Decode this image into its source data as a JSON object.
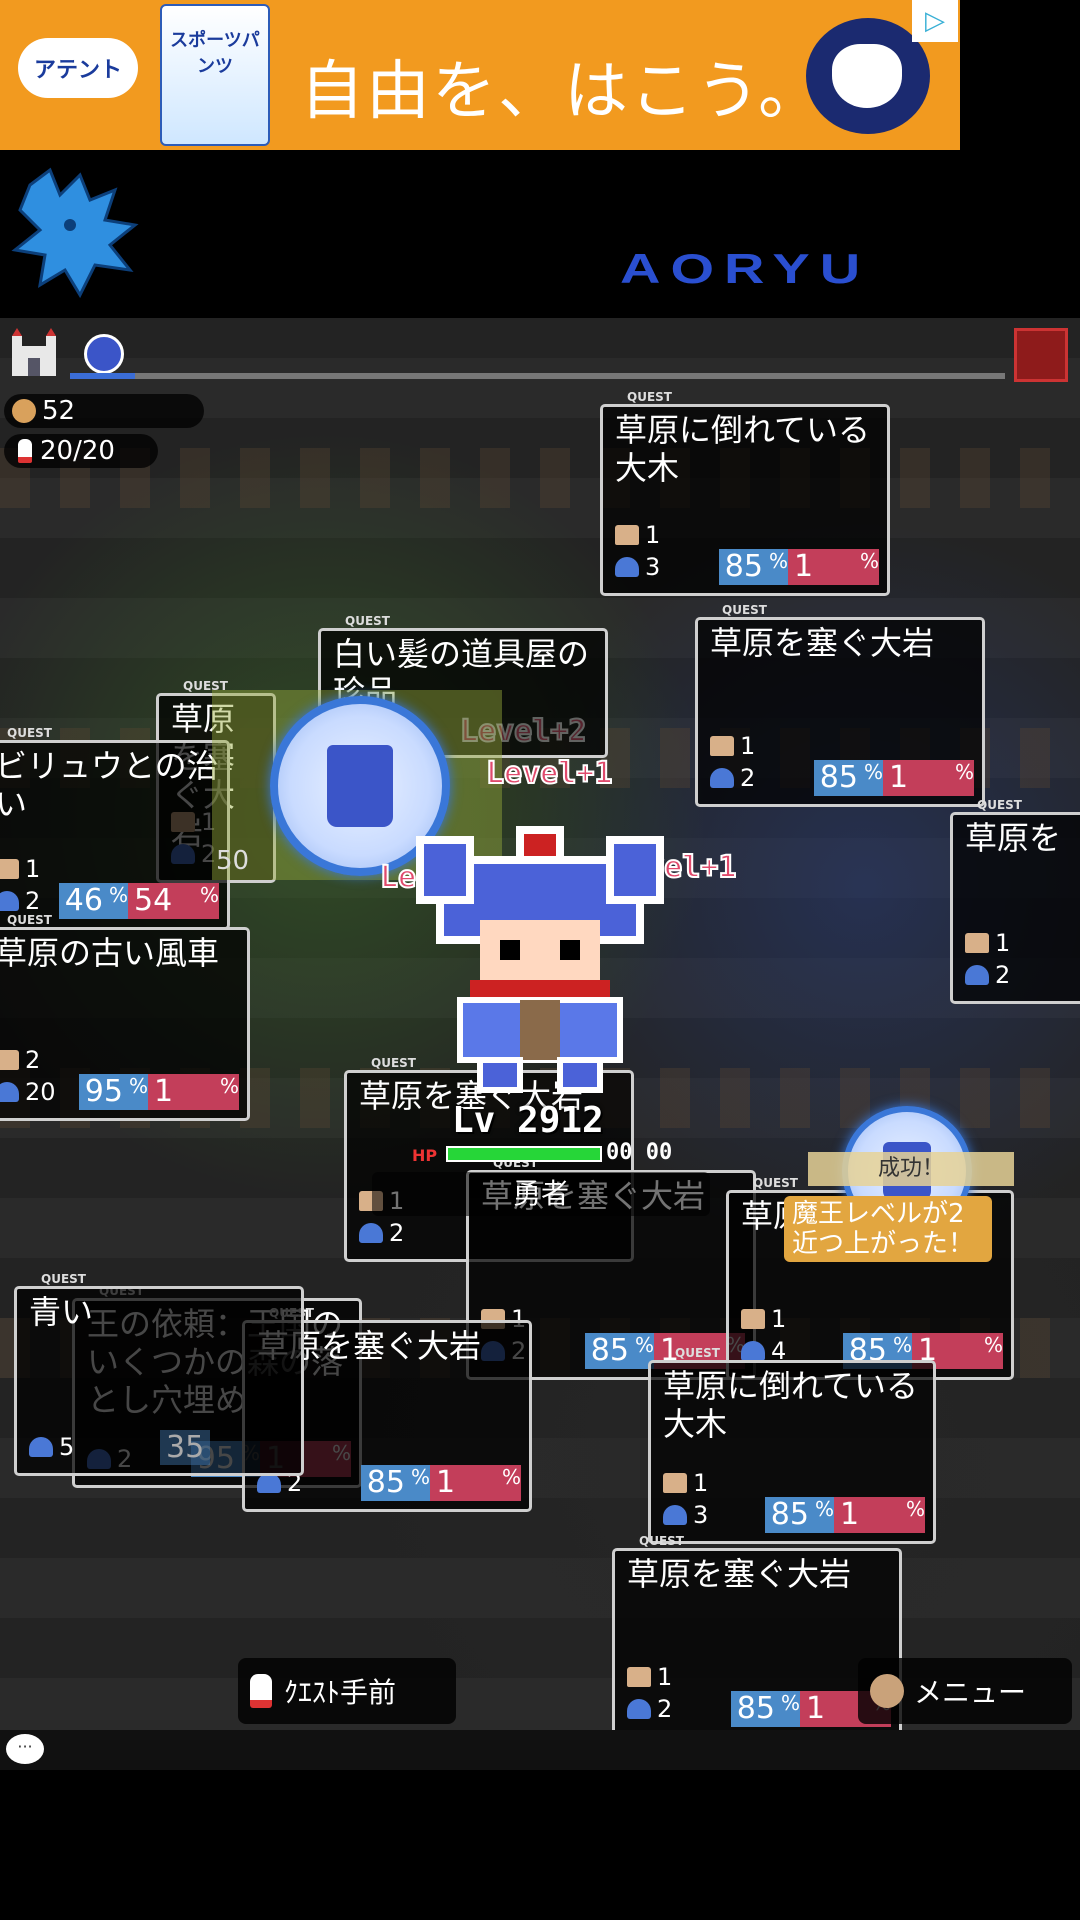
{
  "ad": {
    "brand": "アテント",
    "product": "スポーツパンツ",
    "slogan": "自由を、はこう。",
    "choice_icon": "ad-choices-icon"
  },
  "logo": {
    "text": "AORYU"
  },
  "stats": {
    "coins": "52",
    "quest_count": "20/20"
  },
  "progress": {
    "value": 0.07
  },
  "quest_tag": "QUEST",
  "quests": [
    {
      "id": "q1",
      "title": "草原に倒れている大木",
      "boot": "1",
      "slime": "3",
      "success": "85",
      "risk": "1"
    },
    {
      "id": "q2",
      "title": "草原を塞ぐ大岩",
      "boot": "1",
      "slime": "2",
      "success": "85",
      "risk": "1"
    },
    {
      "id": "q3",
      "title": "白い髪の道具屋の珍品",
      "boot": "",
      "slime": "",
      "success": "",
      "risk": ""
    },
    {
      "id": "q4",
      "title": "草原を塞ぐ大岩",
      "boot": "1",
      "slime": "2",
      "success": "",
      "risk": ""
    },
    {
      "id": "q5",
      "title": "ビリュウとの治い",
      "boot": "1",
      "slime": "2",
      "success": "46",
      "risk": "54"
    },
    {
      "id": "q6",
      "title": "草原を",
      "boot": "1",
      "slime": "2",
      "success": "",
      "risk": ""
    },
    {
      "id": "q7",
      "title": "草原の古い風車",
      "boot": "2",
      "slime": "20",
      "success": "95",
      "risk": "1"
    },
    {
      "id": "q8",
      "title": "草原を塞ぐ大岩",
      "boot": "1",
      "slime": "2",
      "success": "",
      "risk": ""
    },
    {
      "id": "q9",
      "title": "草原を塞ぐ大岩",
      "boot": "1",
      "slime": "2",
      "success": "85",
      "risk": "1"
    },
    {
      "id": "q10",
      "title": "草原を塞ぐ大岩",
      "boot": "1",
      "slime": "4",
      "success": "85",
      "risk": "1"
    },
    {
      "id": "q11",
      "title": "王の依頼：王国のいくつかの森の落とし穴埋め",
      "boot": "",
      "slime": "2",
      "success": "95",
      "risk": "1"
    },
    {
      "id": "q12",
      "title": "草原を塞ぐ大岩",
      "boot": "",
      "slime": "2",
      "success": "85",
      "risk": "1"
    },
    {
      "id": "q13",
      "title": "草原に倒れている大木",
      "boot": "1",
      "slime": "3",
      "success": "85",
      "risk": "1"
    },
    {
      "id": "q14",
      "title": "草原を塞ぐ大岩",
      "boot": "1",
      "slime": "2",
      "success": "85",
      "risk": "1"
    },
    {
      "id": "q15",
      "title": "青い",
      "boot": "",
      "slime": "5",
      "success": "",
      "risk": ""
    }
  ],
  "ghost_numbers": {
    "a": "50",
    "b": "35"
  },
  "levelups": [
    "Level+1",
    "Level+1",
    "Level+1",
    "Level+2"
  ],
  "hero": {
    "level": "Lv 2912",
    "hp_label": "HP",
    "hp_value": "00 00",
    "name": "勇者",
    "hp": 1.0
  },
  "toasts": {
    "success": "成功！",
    "demon": "魔王レベルが2近つ上がった！"
  },
  "buttons": {
    "quest_prev": "ｸｴｽﾄ手前",
    "menu": "メニュー"
  },
  "colors": {
    "success": "#4a8ac8",
    "risk": "#c33e5a",
    "hp": "#26d638",
    "frame": "#3a77d8"
  }
}
